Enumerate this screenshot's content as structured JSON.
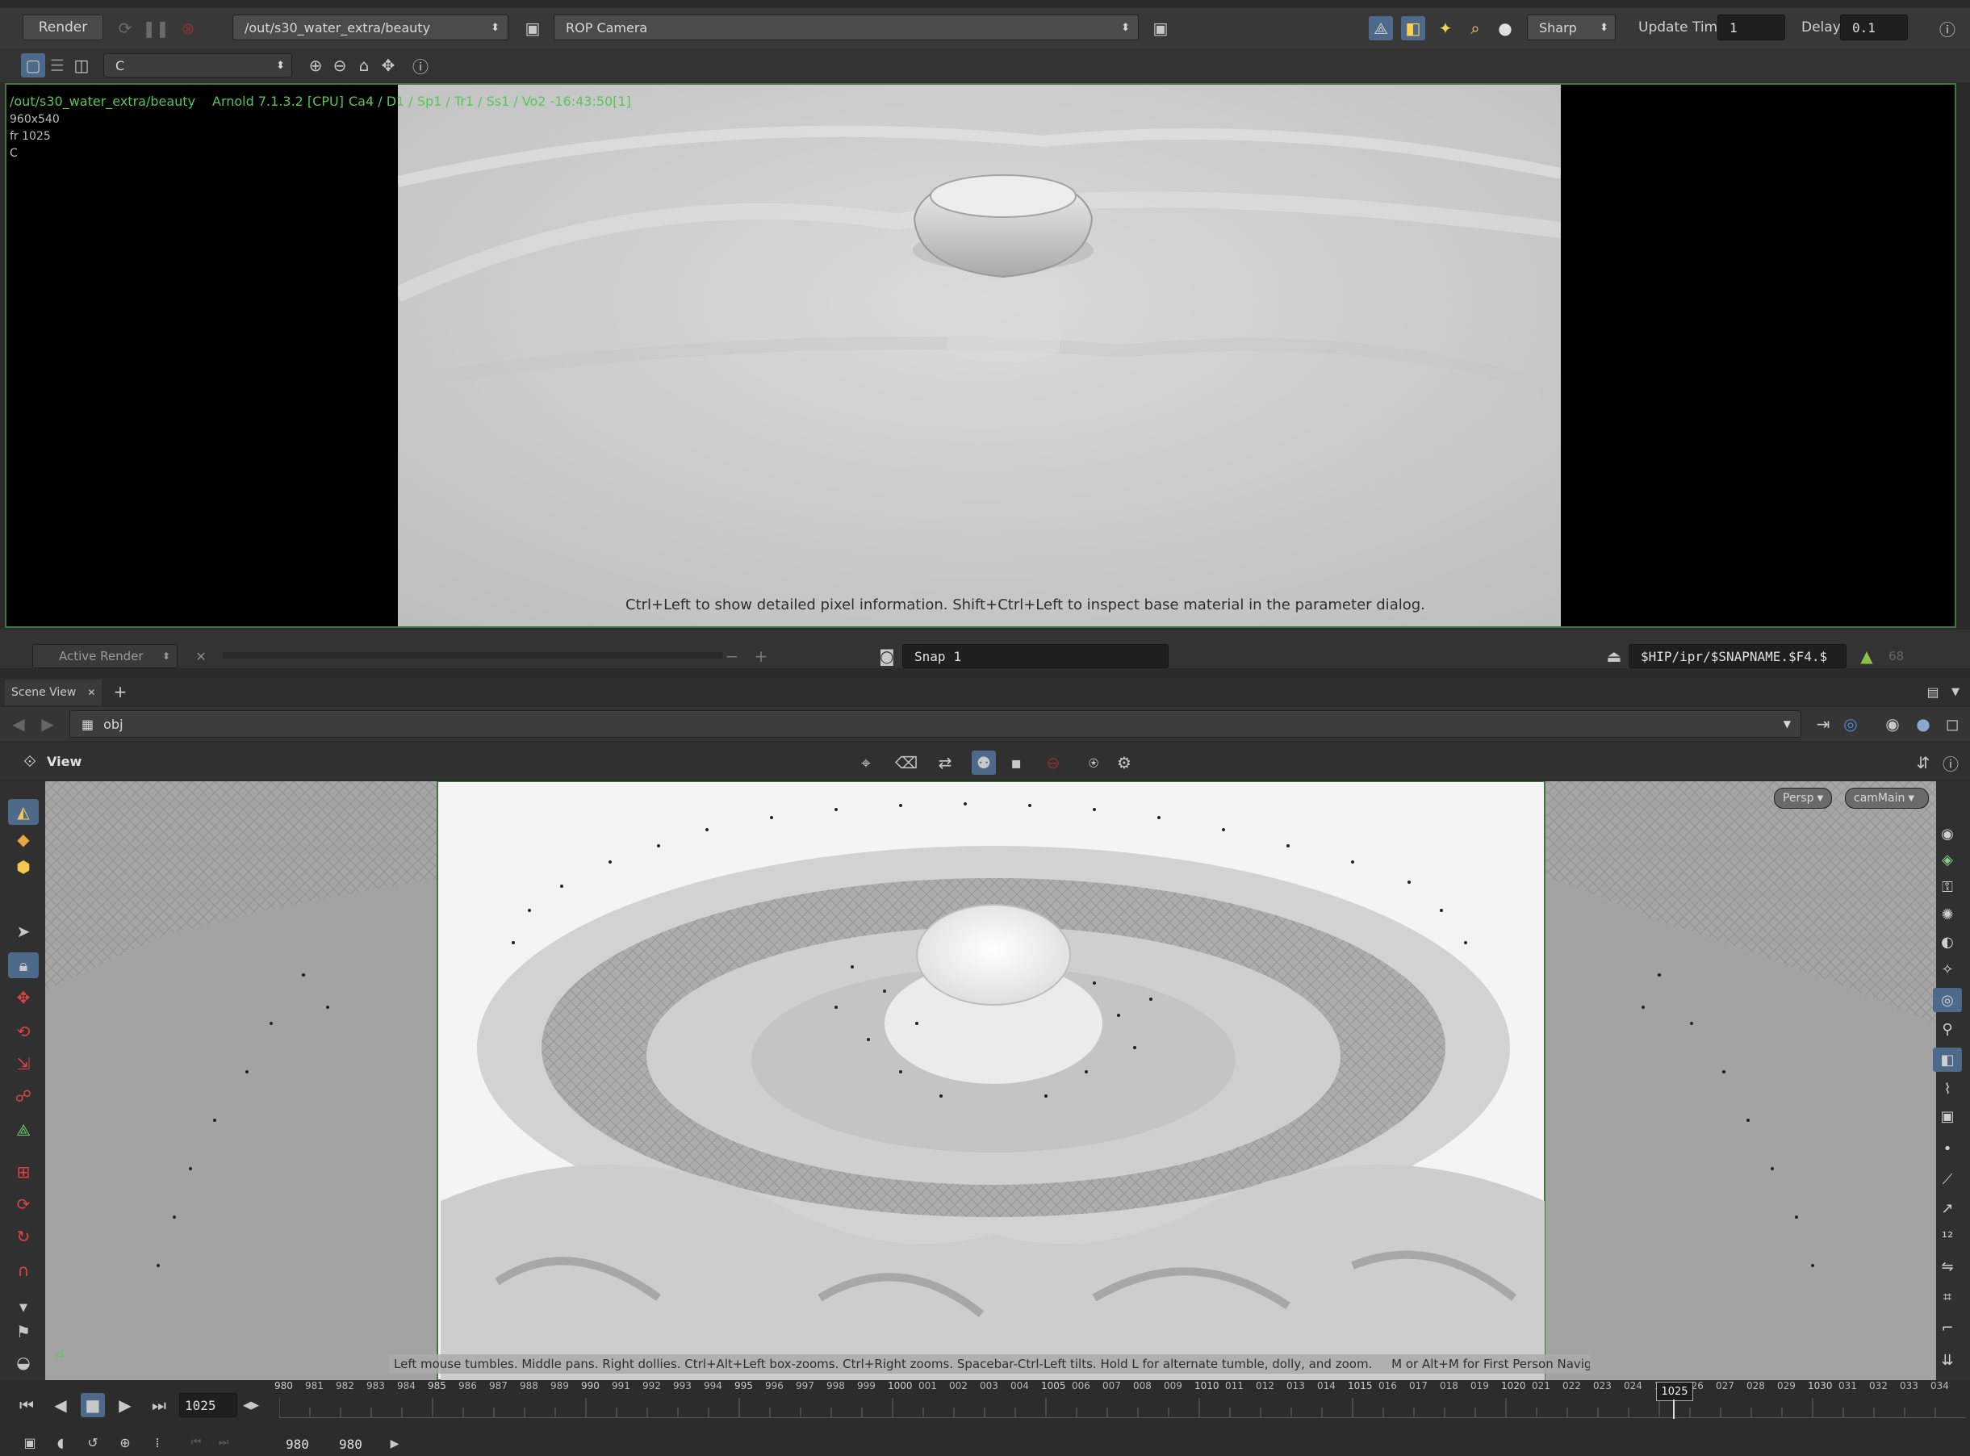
{
  "render_toolbar": {
    "render_button": "Render",
    "rop_path": "/out/s30_water_extra/beauty",
    "camera": "ROP Camera",
    "quality": "Sharp",
    "update_time_label": "Update Time",
    "update_time_value": "1",
    "delay_label": "Delay",
    "delay_value": "0.1"
  },
  "render_view": {
    "channel": "C",
    "overlay_path": "/out/s30_water_extra/beauty",
    "overlay_renderer": "Arnold 7.1.3.2 [CPU]",
    "overlay_samples": "Ca4 / D1 / Sp1 / Tr1 / Ss1 / Vo2 -16:43:50[1]",
    "resolution": "960x540",
    "frame": "fr 1025",
    "channel_meta": "C",
    "hint": "Ctrl+Left to show detailed pixel information. Shift+Ctrl+Left to inspect base material in the parameter dialog."
  },
  "render_status": {
    "active_render": "Active Render",
    "snap_label": "Snap",
    "snap_value": "1",
    "snapshot_path": "$HIP/ipr/$SNAPNAME.$F4.$",
    "count": "68"
  },
  "scene_view": {
    "tab": "Scene View",
    "path": "obj",
    "view_label": "View",
    "persp": "Persp",
    "camera": "camMain",
    "hint": "Left mouse tumbles. Middle pans. Right dollies. Ctrl+Alt+Left box-zooms. Ctrl+Right zooms. Spacebar-Ctrl-Left tilts. Hold L for alternate tumble, dolly, and zoom.     M or Alt+M for First Person Navigation."
  },
  "timeline": {
    "current_frame": "1025",
    "range_start": "980",
    "range_end": "980",
    "ticks": [
      "980",
      "981",
      "982",
      "983",
      "984",
      "985",
      "986",
      "987",
      "988",
      "989",
      "990",
      "991",
      "992",
      "993",
      "994",
      "995",
      "996",
      "997",
      "998",
      "999",
      "1000",
      "001",
      "002",
      "003",
      "004",
      "1005",
      "006",
      "007",
      "008",
      "009",
      "1010",
      "011",
      "012",
      "013",
      "014",
      "1015",
      "016",
      "017",
      "018",
      "019",
      "1020",
      "021",
      "022",
      "023",
      "024",
      "1025",
      "026",
      "027",
      "028",
      "029",
      "1030",
      "031",
      "032",
      "033",
      "034"
    ],
    "marker": "1025"
  }
}
